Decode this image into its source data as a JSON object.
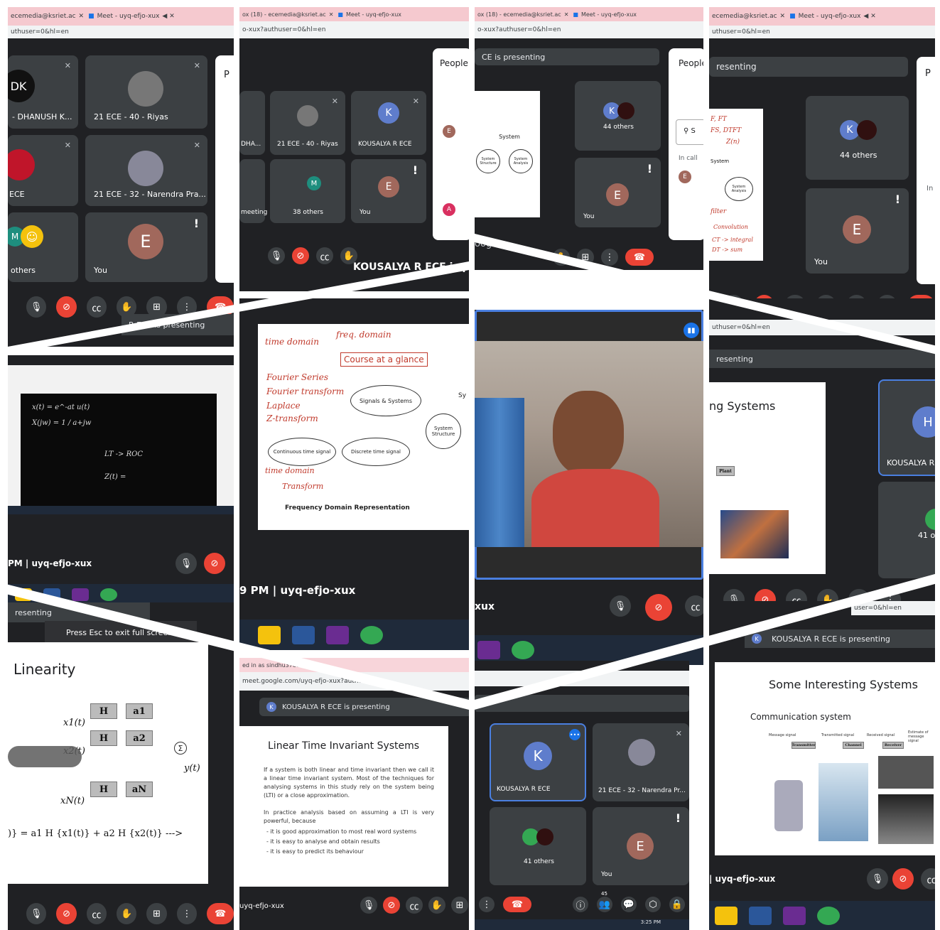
{
  "tiles": {
    "t1": {
      "tab1": "ecemedia@ksriet.ac",
      "tab2": "Meet - uyq-efjo-xux",
      "url": "uthuser=0&hl=en",
      "names": [
        "- DHANUSH K...",
        "21 ECE - 40 - Riyas",
        "ECE",
        "21 ECE - 32 - Narendra Pra...",
        "others",
        "You"
      ],
      "avatar_e": "E",
      "presenting": "R ECE is presenting",
      "people_cut": "P"
    },
    "t2": {
      "tab1": "ox (18) - ecemedia@ksriet.ac",
      "tab2": "Meet - uyq-efjo-xux",
      "url": "o-xux?authuser=0&hl=en",
      "people": "People",
      "names": [
        "DHA...",
        "21 ECE - 40 - Riyas",
        "KOUSALYA R ECE",
        "meeting",
        "38 others",
        "You"
      ],
      "k": "K",
      "m": "M",
      "e": "E",
      "a": "A",
      "banner": "KOUSALYA R ECE is pre"
    },
    "t3": {
      "tab1": "ox (18) - ecemedia@ksriet.ac",
      "tab2": "Meet - uyq-efjo-xux",
      "url": "o-xux?authuser=0&hl=en",
      "presenting": "CE is presenting",
      "people": "People",
      "search": "S",
      "incall": "In call",
      "others": "44 others",
      "you": "You",
      "k": "K",
      "e": "E",
      "diagram": [
        "System",
        "System Structure",
        "System Analysis"
      ],
      "google": "oogle"
    },
    "t4": {
      "tab1": "ecemedia@ksriet.ac",
      "tab2": "Meet - uyq-efjo-xux",
      "url": "uthuser=0&hl=en",
      "presenting": "resenting",
      "others": "44 others",
      "you": "You",
      "k": "K",
      "e": "E",
      "people_cut": "P",
      "in_cut": "In",
      "notes": [
        "F, FT",
        "FS, DTFT",
        "Z(n)",
        "System",
        "filter",
        "Convolution",
        "CT -> integral",
        "DT -> sum"
      ]
    },
    "t5": {
      "meeting": "PM  |  uyq-efjo-xux",
      "board": [
        "x(t) = e^-at u(t)",
        "X(jw) = 1 / a+jw",
        "LT -> ROC",
        "Z(t) ="
      ]
    },
    "t6": {
      "meeting": "9 PM  |  uyq-efjo-xux",
      "title": "Course at a glance",
      "nodes": [
        "Signals & Systems",
        "Continuous time signal",
        "Discrete time signal",
        "System Structure",
        "Frequency Domain Representation",
        "Sy"
      ],
      "notes": [
        "Fourier Series",
        "Fourier transform",
        "Laplace",
        "Z-transform",
        "time domain",
        "freq. domain",
        "time domain",
        "Transform"
      ]
    },
    "t7": {
      "meeting": "xux"
    },
    "t8": {
      "url": "uthuser=0&hl=en",
      "presenting": "resenting",
      "slide_title": "ng Systems",
      "name": "KOUSALYA R",
      "others": "41 o",
      "h": "H"
    },
    "t9": {
      "presenting": "resenting",
      "esc": "Press  Esc  to exit full screen",
      "title": "Linearity",
      "h": "H",
      "labels": [
        "x1(t)",
        "x2(t)",
        "xN(t)",
        "y(t)",
        "a1",
        "a2",
        "aN"
      ],
      "formula": ")} = a1 H {x1(t)} + a2 H {x2(t)} --->"
    },
    "t10": {
      "tab": "ed in as sindhu37ec",
      "url": "meet.google.com/uyq-efjo-xux?authuser",
      "presenting": "KOUSALYA R ECE is presenting",
      "title": "Linear Time Invariant Systems",
      "p1": "If a system is both linear and time invariant then we call it a linear time invariant system. Most of the techniques for analysing systems in this study rely on the system being (LTI) or a close approximation.",
      "p2": "In practice analysis based on assuming a LTI is very powerful, because",
      "b1": "- it is good approximation to most real word systems",
      "b2": "- it is easy to analyse and obtain results",
      "b3": "- it is easy to predict its behaviour",
      "meeting": "uyq-efjo-xux"
    },
    "t11": {
      "names": [
        "KOUSALYA R ECE",
        "21 ECE - 32 - Narendra Pr...",
        "41 others",
        "You"
      ],
      "k": "K",
      "e": "E",
      "count": "45",
      "time": "3:25 PM"
    },
    "t12": {
      "url": "user=0&hl=en",
      "presenting": "KOUSALYA R ECE is presenting",
      "title": "Some Interesting Systems",
      "subtitle": "Communication system",
      "blocks": [
        "Message signal",
        "Transmitter",
        "Transmitted signal",
        "Channel",
        "Received signal",
        "Receiver",
        "Estimate of message signal"
      ],
      "meeting": "|  uyq-efjo-xux"
    }
  }
}
